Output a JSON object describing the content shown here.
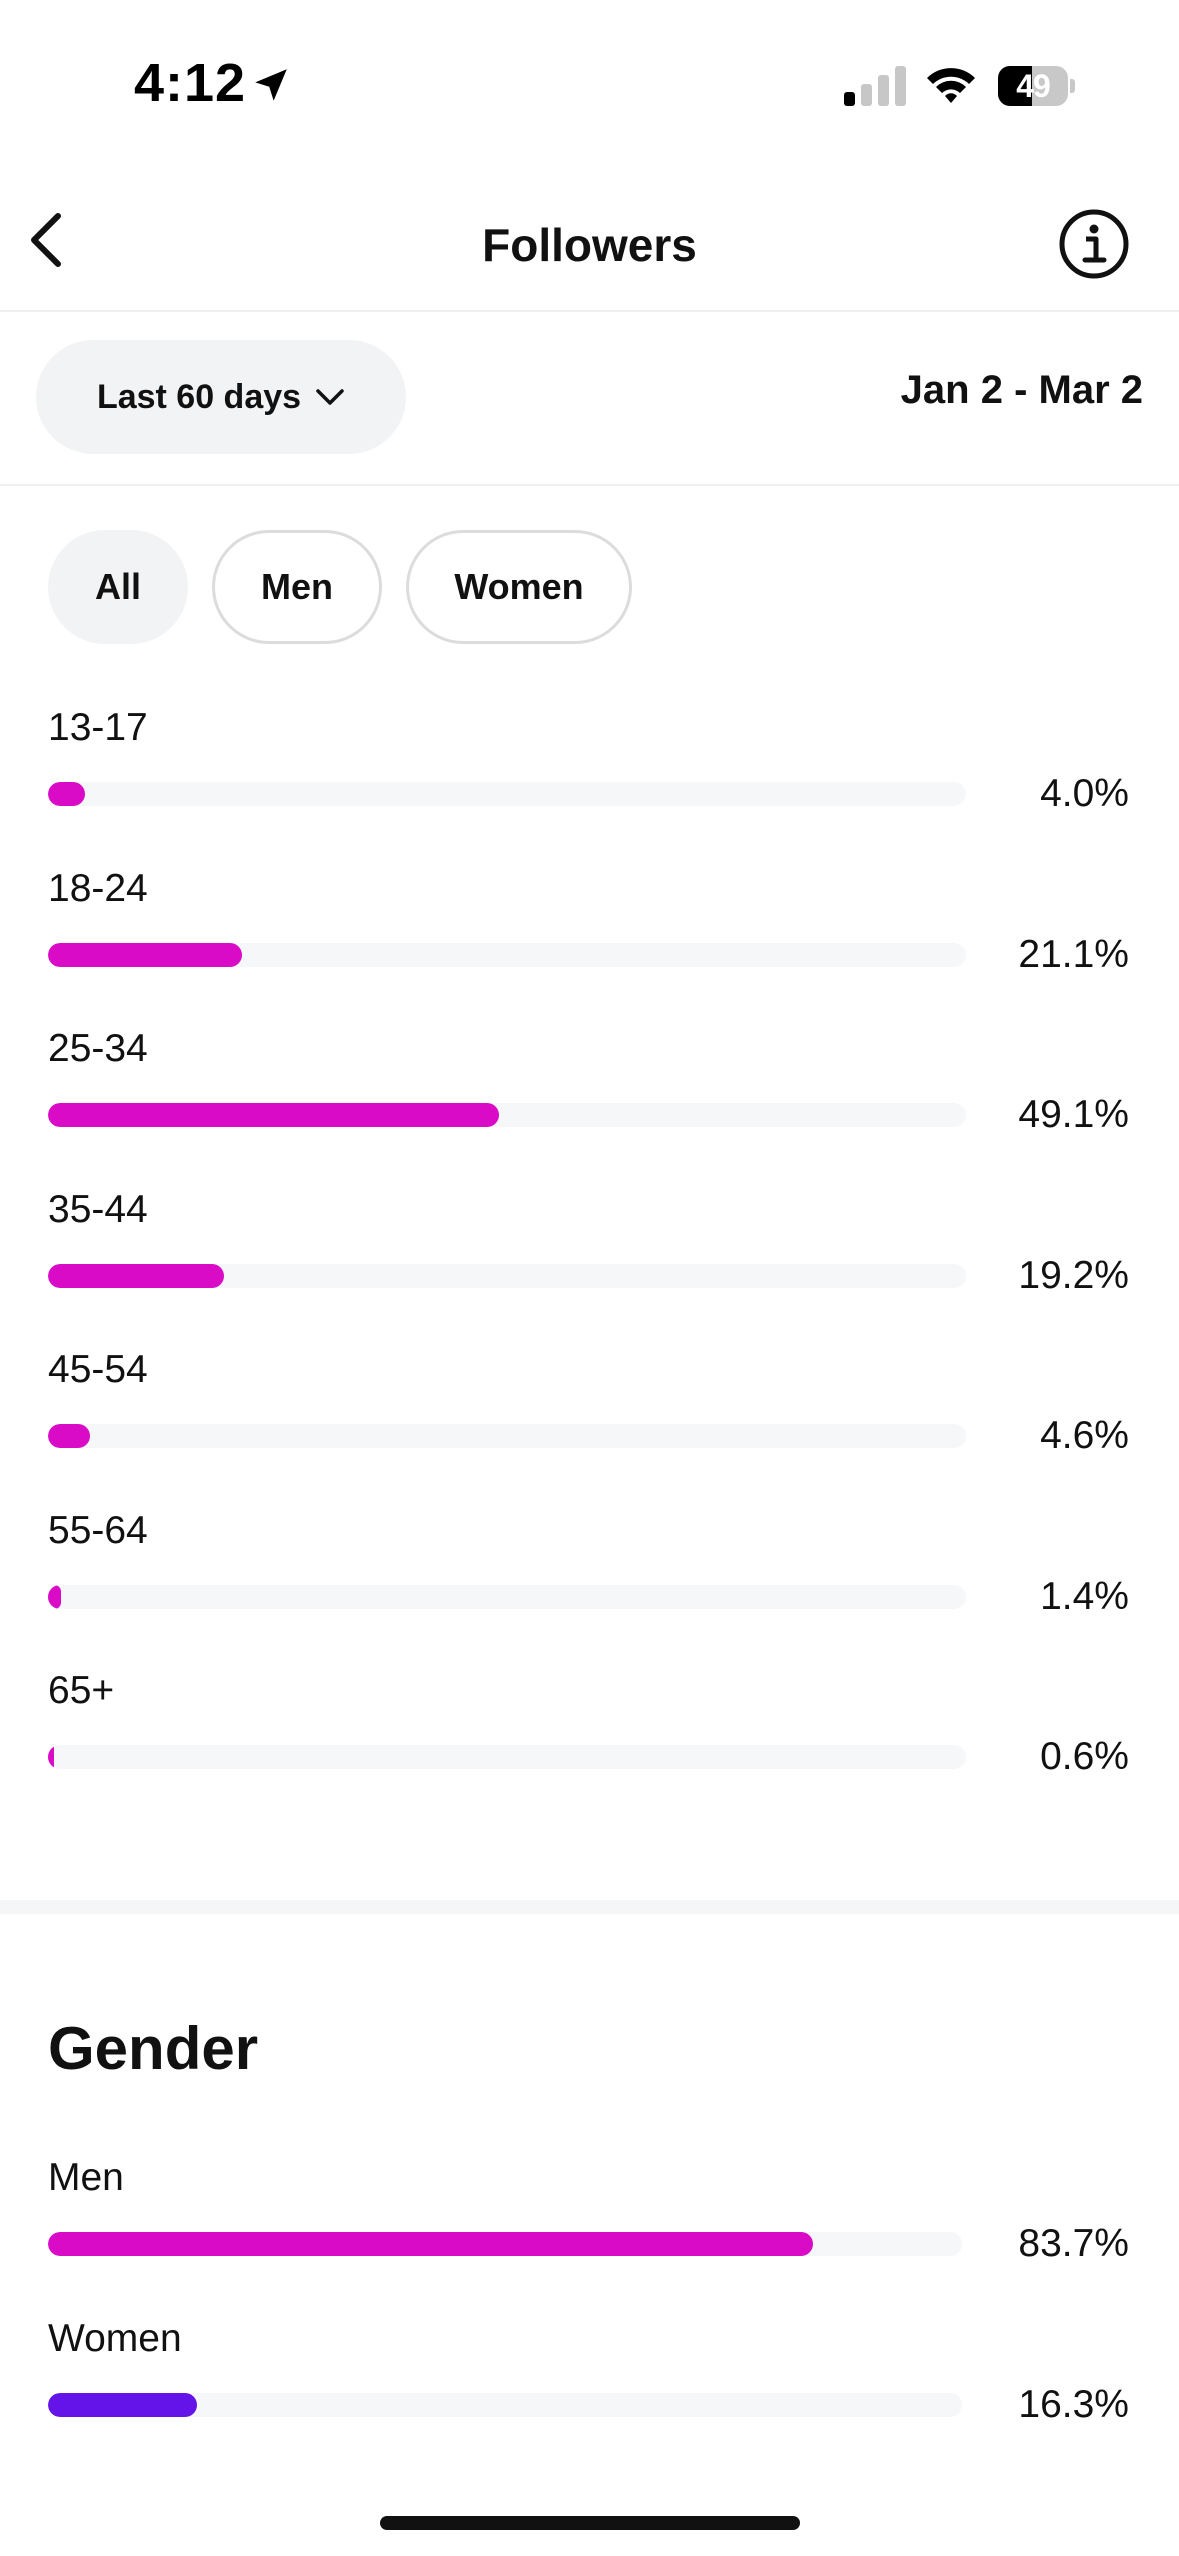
{
  "status_bar": {
    "time": "4:12",
    "battery": "49",
    "battery_level": 0.49
  },
  "header": {
    "title": "Followers"
  },
  "filter": {
    "range_label": "Last 60 days",
    "date_range": "Jan 2 - Mar 2"
  },
  "segments": [
    {
      "label": "All",
      "active": true
    },
    {
      "label": "Men",
      "active": false
    },
    {
      "label": "Women",
      "active": false
    }
  ],
  "age": {
    "bar_color": "#d90bc7",
    "items": [
      {
        "label": "13-17",
        "value_text": "4.0%",
        "percent": 4.0
      },
      {
        "label": "18-24",
        "value_text": "21.1%",
        "percent": 21.1
      },
      {
        "label": "25-34",
        "value_text": "49.1%",
        "percent": 49.1
      },
      {
        "label": "35-44",
        "value_text": "19.2%",
        "percent": 19.2
      },
      {
        "label": "45-54",
        "value_text": "4.6%",
        "percent": 4.6
      },
      {
        "label": "55-64",
        "value_text": "1.4%",
        "percent": 1.4
      },
      {
        "label": "65+",
        "value_text": "0.6%",
        "percent": 0.6
      }
    ]
  },
  "gender": {
    "title": "Gender",
    "items": [
      {
        "label": "Men",
        "value_text": "83.7%",
        "percent": 83.7,
        "color": "#d90bc7"
      },
      {
        "label": "Women",
        "value_text": "16.3%",
        "percent": 16.3,
        "color": "#6414e8"
      }
    ]
  }
}
